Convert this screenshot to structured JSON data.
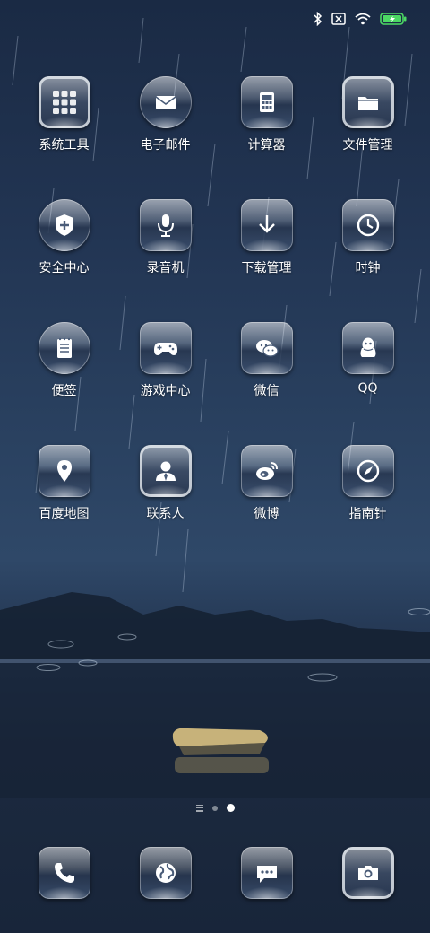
{
  "status_bar": {
    "icons": [
      "bluetooth-icon",
      "no-sim-icon",
      "wifi-icon",
      "battery-charging-icon"
    ],
    "battery_color": "#4cd964"
  },
  "apps": [
    {
      "label": "系统工具",
      "icon": "folder-grid-icon"
    },
    {
      "label": "电子邮件",
      "icon": "mail-icon"
    },
    {
      "label": "计算器",
      "icon": "calculator-icon"
    },
    {
      "label": "文件管理",
      "icon": "folder-icon"
    },
    {
      "label": "安全中心",
      "icon": "shield-plus-icon"
    },
    {
      "label": "录音机",
      "icon": "microphone-icon"
    },
    {
      "label": "下载管理",
      "icon": "download-arrow-icon"
    },
    {
      "label": "时钟",
      "icon": "clock-icon"
    },
    {
      "label": "便签",
      "icon": "notepad-icon"
    },
    {
      "label": "游戏中心",
      "icon": "gamepad-icon"
    },
    {
      "label": "微信",
      "icon": "wechat-icon"
    },
    {
      "label": "QQ",
      "icon": "qq-penguin-icon"
    },
    {
      "label": "百度地图",
      "icon": "map-pin-icon"
    },
    {
      "label": "联系人",
      "icon": "contact-person-icon"
    },
    {
      "label": "微博",
      "icon": "weibo-icon"
    },
    {
      "label": "指南针",
      "icon": "compass-icon"
    }
  ],
  "pager": {
    "page_count": 2,
    "active_page": 2
  },
  "dock": [
    {
      "icon": "phone-icon"
    },
    {
      "icon": "browser-globe-icon"
    },
    {
      "icon": "messages-icon"
    },
    {
      "icon": "camera-icon"
    }
  ]
}
